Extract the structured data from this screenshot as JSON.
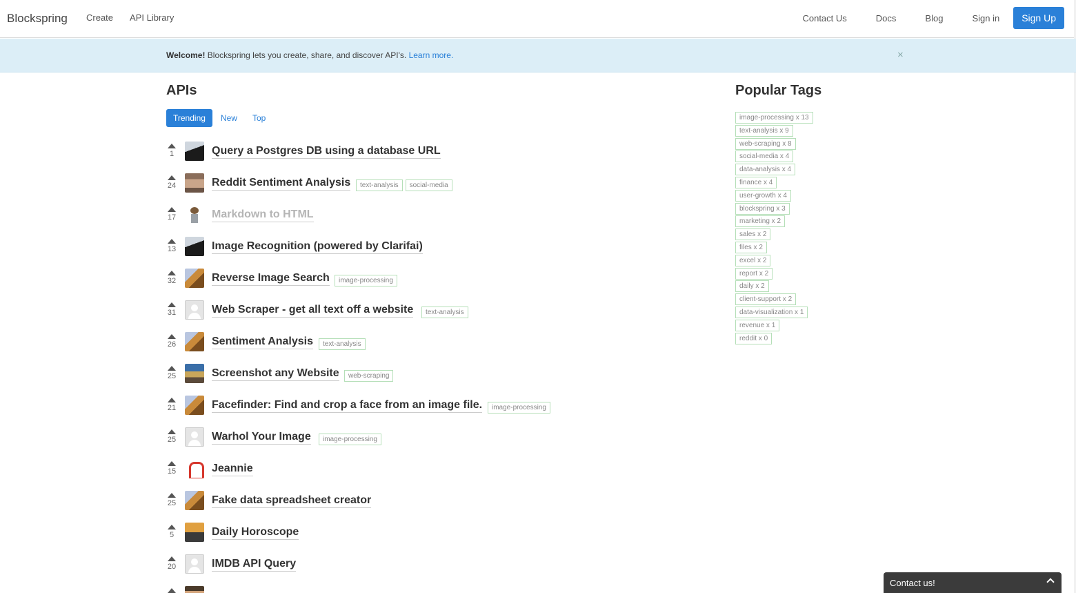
{
  "nav": {
    "brand": "Blockspring",
    "left": [
      "Create",
      "API Library"
    ],
    "right": [
      "Contact Us",
      "Docs",
      "Blog",
      "Sign in"
    ],
    "signup": "Sign Up"
  },
  "banner": {
    "bold": "Welcome!",
    "text": " Blockspring lets you create, share, and discover API's. ",
    "link": "Learn more.",
    "close": "×"
  },
  "apis": {
    "title": "APIs",
    "tabs": [
      "Trending",
      "New",
      "Top"
    ],
    "items": [
      {
        "votes": "1",
        "title": "Query a Postgres DB using a database URL",
        "avatar": "dark",
        "tags": [],
        "muted": false
      },
      {
        "votes": "24",
        "title": "Reddit Sentiment Analysis",
        "avatar": "person",
        "tags": [
          "text-analysis",
          "social-media"
        ],
        "muted": false
      },
      {
        "votes": "17",
        "title": "Markdown to HTML",
        "avatar": "sketch",
        "tags": [],
        "muted": true
      },
      {
        "votes": "13",
        "title": "Image Recognition (powered by Clarifai)",
        "avatar": "dark",
        "tags": [],
        "muted": false
      },
      {
        "votes": "32",
        "title": "Reverse Image Search",
        "avatar": "giraffe",
        "tags": [
          "image-processing"
        ],
        "muted": false
      },
      {
        "votes": "31",
        "title": "Web Scraper - get all text off a website",
        "avatar": "blank",
        "tags": [
          "text-analysis"
        ],
        "muted": false
      },
      {
        "votes": "26",
        "title": "Sentiment Analysis",
        "avatar": "giraffe",
        "tags": [
          "text-analysis"
        ],
        "muted": false
      },
      {
        "votes": "25",
        "title": "Screenshot any Website",
        "avatar": "screen",
        "tags": [
          "web-scraping"
        ],
        "muted": false
      },
      {
        "votes": "21",
        "title": "Facefinder: Find and crop a face from an image file.",
        "avatar": "giraffe",
        "tags": [
          "image-processing"
        ],
        "muted": false
      },
      {
        "votes": "25",
        "title": "Warhol Your Image",
        "avatar": "blank",
        "tags": [
          "image-processing"
        ],
        "muted": false
      },
      {
        "votes": "15",
        "title": "Jeannie",
        "avatar": "red",
        "tags": [],
        "muted": false
      },
      {
        "votes": "25",
        "title": "Fake data spreadsheet creator",
        "avatar": "giraffe",
        "tags": [],
        "muted": false
      },
      {
        "votes": "5",
        "title": "Daily Horoscope",
        "avatar": "orange",
        "tags": [],
        "muted": false
      },
      {
        "votes": "20",
        "title": "IMDB API Query",
        "avatar": "blank",
        "tags": [],
        "muted": false
      },
      {
        "votes": "",
        "title": "",
        "avatar": "beard",
        "tags": [],
        "muted": false
      }
    ]
  },
  "popular_tags": {
    "title": "Popular Tags",
    "items": [
      "image-processing x 13",
      "text-analysis x 9",
      "web-scraping x 8",
      "social-media x 4",
      "data-analysis x 4",
      "finance x 4",
      "user-growth x 4",
      "blockspring x 3",
      "marketing x 2",
      "sales x 2",
      "files x 2",
      "excel x 2",
      "report x 2",
      "daily x 2",
      "client-support x 2",
      "data-visualization x 1",
      "revenue x 1",
      "reddit x 0"
    ]
  },
  "contact_widget": {
    "label": "Contact us!",
    "icon": "chevron-up-icon"
  },
  "colors": {
    "primary": "#2a80d8",
    "banner_bg": "#dceef7",
    "tag_border": "#b5dfb8"
  }
}
